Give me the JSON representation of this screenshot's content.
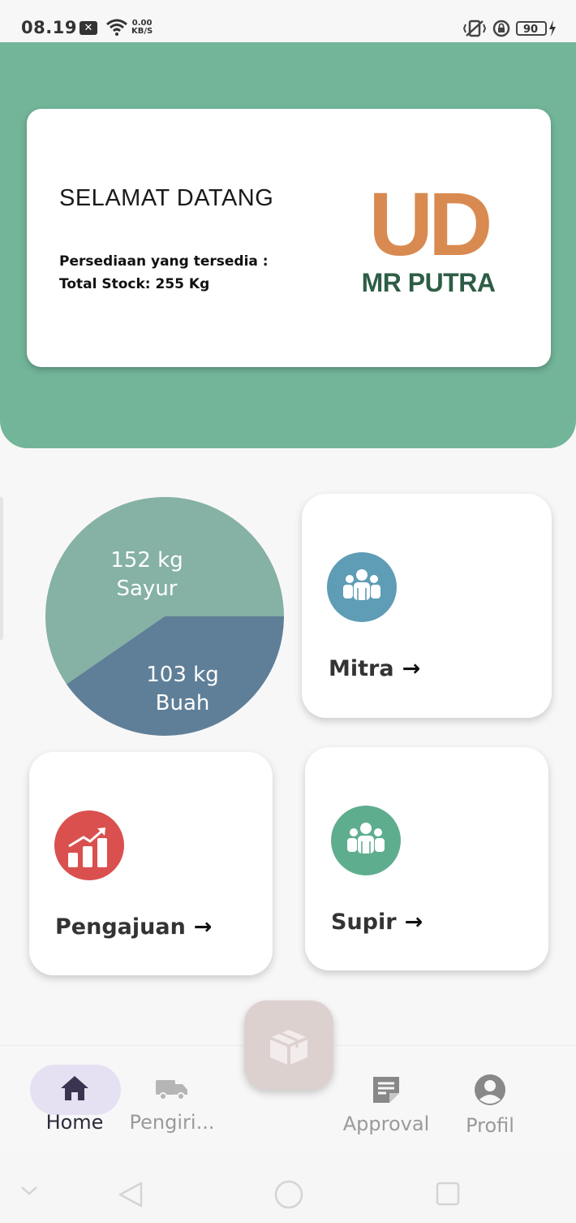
{
  "status_bar": {
    "time": "08.19",
    "notification_badge": "✕",
    "speed_value": "0.00",
    "speed_unit": "KB/S",
    "battery": "90"
  },
  "welcome": {
    "title": "SELAMAT DATANG",
    "stock_label": "Persediaan yang tersedia :",
    "total_stock": "Total Stock: 255 Kg",
    "logo_top": "UD",
    "logo_bottom": "MR PUTRA"
  },
  "chart_data": {
    "type": "pie",
    "title": "",
    "slices": [
      {
        "name": "Sayur",
        "value": 152,
        "unit": "kg",
        "label_value": "152 kg",
        "label_name": "Sayur",
        "color": "#86b1a5"
      },
      {
        "name": "Buah",
        "value": 103,
        "unit": "kg",
        "label_value": "103 kg",
        "label_name": "Buah",
        "color": "#5f7f98"
      }
    ]
  },
  "menu": {
    "mitra": {
      "label": "Mitra",
      "arrow": "→",
      "icon": "group-icon",
      "color": "#5f9cb6"
    },
    "pengajuan": {
      "label": "Pengajuan",
      "arrow": "→",
      "icon": "chart-growth-icon",
      "color": "#d9504e"
    },
    "supir": {
      "label": "Supir",
      "arrow": "→",
      "icon": "group-icon",
      "color": "#5fad8f"
    }
  },
  "bottom_nav": {
    "home": "Home",
    "pengiriman": "Pengiri...",
    "approval": "Approval",
    "profil": "Profil",
    "fab_icon": "box-icon"
  },
  "colors": {
    "header": "#72b599",
    "logo_orange": "#d98a50",
    "logo_green": "#2d5e45",
    "fab": "#ddd1d0",
    "active_pill": "#e5e1f2"
  }
}
